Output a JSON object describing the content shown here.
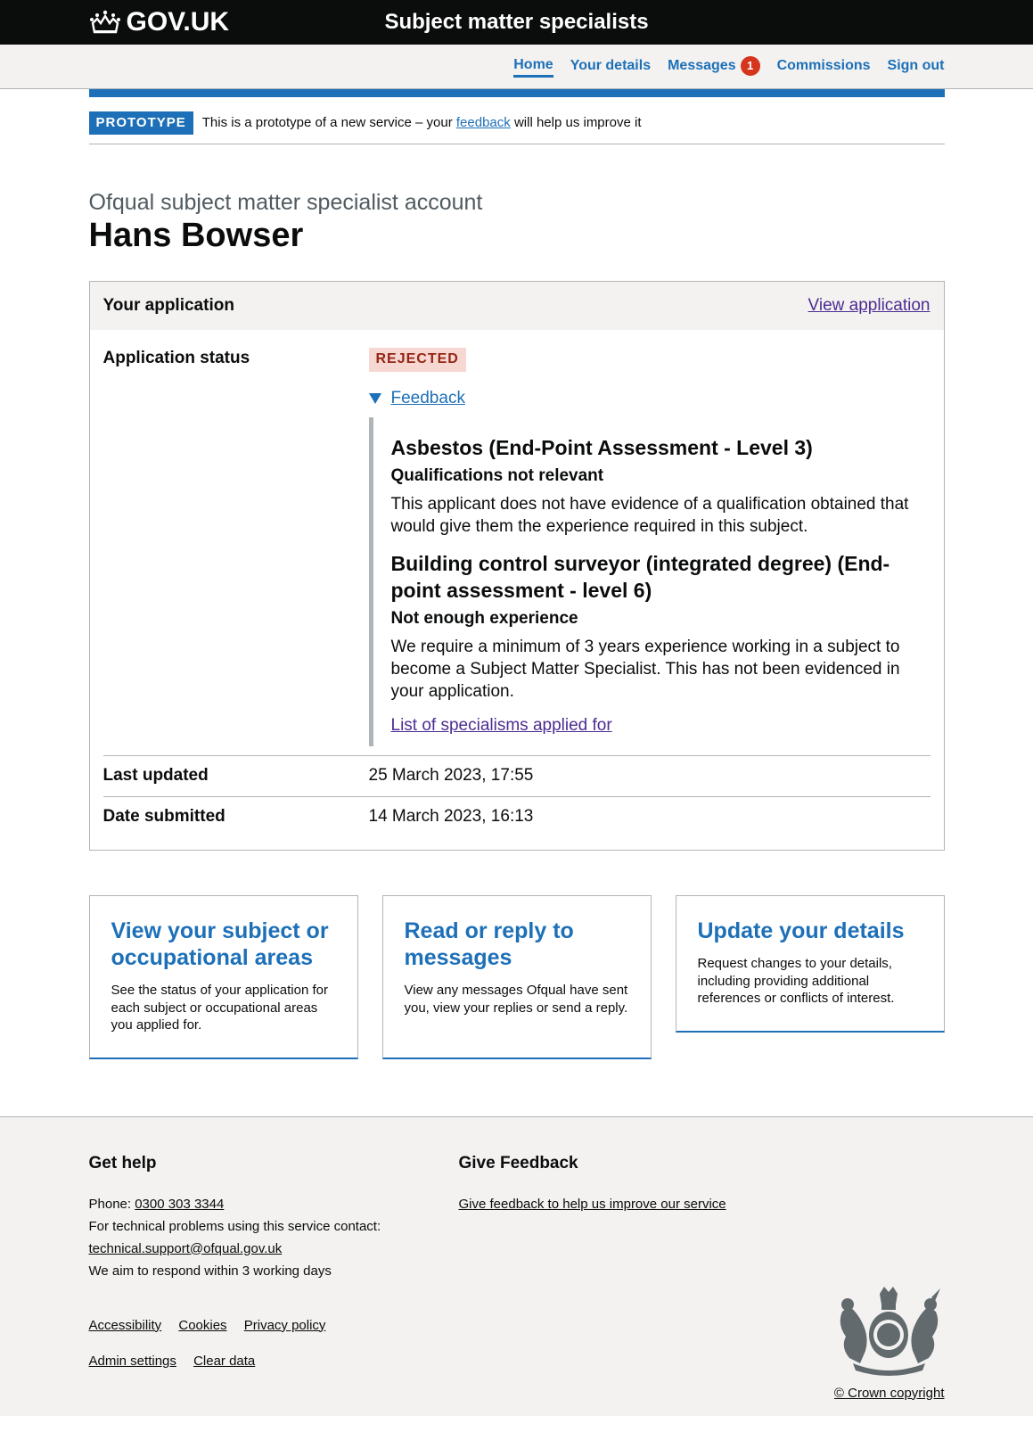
{
  "header": {
    "logo_text": "GOV.UK",
    "service_name": "Subject matter specialists"
  },
  "nav": {
    "home": "Home",
    "your_details": "Your details",
    "messages": "Messages",
    "messages_count": "1",
    "commissions": "Commissions",
    "sign_out": "Sign out"
  },
  "phase_banner": {
    "tag": "PROTOTYPE",
    "text_before": "This is a prototype of a new service – your ",
    "link": "feedback",
    "text_after": " will help us improve it"
  },
  "page": {
    "caption": "Ofqual subject matter specialist account",
    "title": "Hans Bowser"
  },
  "application_card": {
    "heading": "Your application",
    "view_link": "View application",
    "status_label": "Application status",
    "status_value": "Rejected",
    "feedback_summary": "Feedback",
    "feedback_items": [
      {
        "subject": "Asbestos (End-Point Assessment - Level 3)",
        "reason": "Qualifications not relevant",
        "detail": "This applicant does not have evidence of a qualification obtained that would give them the experience required in this subject."
      },
      {
        "subject": "Building control surveyor (integrated degree) (End-point assessment - level 6)",
        "reason": "Not enough experience",
        "detail": "We require a minimum of 3 years experience working in a subject to become a Subject Matter Specialist. This has not been evidenced in your application."
      }
    ],
    "specialisms_link": "List of specialisms applied for",
    "last_updated_label": "Last updated",
    "last_updated_value": "25 March 2023, 17:55",
    "date_submitted_label": "Date submitted",
    "date_submitted_value": "14 March 2023, 16:13"
  },
  "tiles": [
    {
      "title": "View your subject or occupational areas",
      "text": "See the status of your application for each subject or occupational areas you applied for."
    },
    {
      "title": "Read or reply to messages",
      "text": "View any messages Ofqual have sent you, view your replies or send a reply."
    },
    {
      "title": "Update your details",
      "text": "Request changes to your details, including providing additional references or conflicts of interest."
    }
  ],
  "footer": {
    "help_heading": "Get help",
    "phone_label": "Phone: ",
    "phone": "0300 303 3344",
    "tech_text": "For technical problems using this service contact:",
    "email": "technical.support@ofqual.gov.uk",
    "respond_text": "We aim to respond within 3 working days",
    "feedback_heading": "Give Feedback",
    "feedback_link": "Give feedback to help us improve our service",
    "links_row1": [
      "Accessibility",
      "Cookies",
      "Privacy policy"
    ],
    "links_row2": [
      "Admin settings",
      "Clear data"
    ],
    "copyright": "© Crown copyright"
  },
  "colors": {
    "header_bg": "#0b0c0c",
    "link_blue": "#1d70b8",
    "visited_purple": "#4c2c92",
    "rejected_tag_bg": "#f6d7d2",
    "rejected_tag_text": "#942514",
    "badge_red": "#d4351c",
    "footer_bg": "#f3f2f1"
  },
  "icons": {
    "logo": "crown-icon",
    "details_toggle": "triangle-down-icon",
    "footer_crest": "royal-coat-of-arms-icon"
  }
}
